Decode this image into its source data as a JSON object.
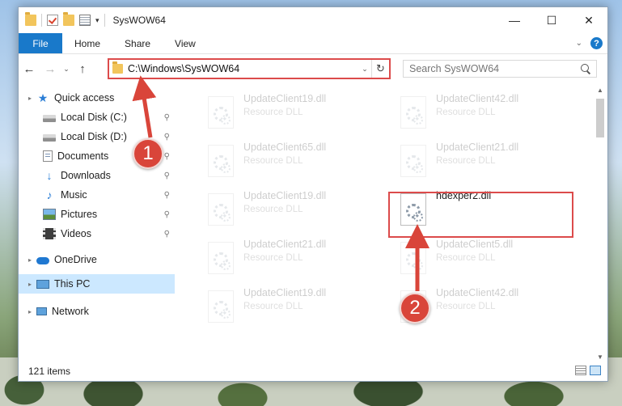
{
  "window": {
    "title": "SysWOW64",
    "controls": {
      "minimize": "—",
      "maximize": "☐",
      "close": "✕"
    }
  },
  "quick_access_toolbar": {
    "dropdown": "▾"
  },
  "ribbon": {
    "tabs": [
      {
        "label": "File"
      },
      {
        "label": "Home"
      },
      {
        "label": "Share"
      },
      {
        "label": "View"
      }
    ],
    "expand": "⌄",
    "help": "?"
  },
  "navigation": {
    "back": "←",
    "forward": "→",
    "recent": "⌄",
    "up": "↑"
  },
  "address_bar": {
    "path": "C:\\Windows\\SysWOW64",
    "dropdown": "⌄",
    "refresh": "↻"
  },
  "search": {
    "placeholder": "Search SysWOW64"
  },
  "nav_pane": {
    "items": [
      {
        "label": "Quick access",
        "icon": "star-icon",
        "pinned": false
      },
      {
        "label": "Local Disk (C:)",
        "icon": "local-disk-icon",
        "pinned": true
      },
      {
        "label": "Local Disk (D:)",
        "icon": "local-disk-icon",
        "pinned": true
      },
      {
        "label": "Documents",
        "icon": "documents-icon",
        "pinned": true
      },
      {
        "label": "Downloads",
        "icon": "downloads-icon",
        "pinned": true
      },
      {
        "label": "Music",
        "icon": "music-icon",
        "pinned": true
      },
      {
        "label": "Pictures",
        "icon": "pictures-icon",
        "pinned": true
      },
      {
        "label": "Videos",
        "icon": "videos-icon",
        "pinned": true
      },
      {
        "label": "OneDrive",
        "icon": "onedrive-icon",
        "pinned": false
      },
      {
        "label": "This PC",
        "icon": "this-pc-icon",
        "pinned": false,
        "selected": true
      },
      {
        "label": "Network",
        "icon": "network-icon",
        "pinned": false
      }
    ],
    "pin_glyph": "📌"
  },
  "files": [
    {
      "name": "UpdateClient19.dll",
      "type": "Resource DLL",
      "faded": true
    },
    {
      "name": "UpdateClient42.dll",
      "type": "Resource DLL",
      "faded": true
    },
    {
      "name": "UpdateClient65.dll",
      "type": "Resource DLL",
      "faded": true
    },
    {
      "name": "UpdateClient21.dll",
      "type": "Resource DLL",
      "faded": true
    },
    {
      "name": "UpdateClient19.dll",
      "type": "Resource DLL",
      "faded": true
    },
    {
      "name": "hdexper2.dll",
      "type": "",
      "faded": false,
      "highlighted": true
    },
    {
      "name": "UpdateClient21.dll",
      "type": "Resource DLL",
      "faded": true
    },
    {
      "name": "UpdateClient5.dll",
      "type": "Resource DLL",
      "faded": true
    },
    {
      "name": "UpdateClient19.dll",
      "type": "Resource DLL",
      "faded": true
    },
    {
      "name": "UpdateClient42.dll",
      "type": "Resource DLL",
      "faded": true
    }
  ],
  "status_bar": {
    "item_count": "121 items"
  },
  "annotations": [
    {
      "label": "1"
    },
    {
      "label": "2"
    }
  ],
  "colors": {
    "accent": "#1979ca",
    "highlight": "#dc4b4b",
    "badge": "#d9453a",
    "selection": "#cce8ff"
  }
}
